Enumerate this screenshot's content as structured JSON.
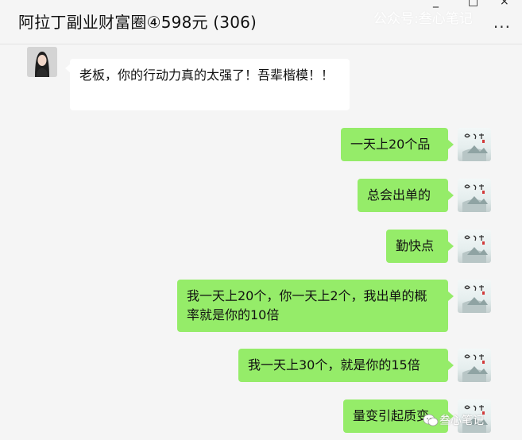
{
  "header": {
    "title": "阿拉丁副业财富圈④598元 (306)",
    "watermark": "公众号:叁心笔记",
    "more_label": "..."
  },
  "window_controls": {
    "minimize": "_",
    "maximize": "□",
    "close": "×"
  },
  "messages": [
    {
      "side": "left",
      "text": " 老板，你的行动力真的太强了！吾辈楷模！！"
    },
    {
      "side": "right",
      "text": "一天上20个品"
    },
    {
      "side": "right",
      "text": "总会出单的"
    },
    {
      "side": "right",
      "text": "勤快点"
    },
    {
      "side": "right",
      "text": "我一天上20个，你一天上2个，我出单的概率就是你的10倍"
    },
    {
      "side": "right",
      "text": "我一天上30个，就是你的15倍"
    },
    {
      "side": "right",
      "text": "量变引起质变"
    }
  ],
  "watermark_bottom": "叁心笔记",
  "colors": {
    "self_bubble": "#95ec69",
    "other_bubble": "#ffffff",
    "background": "#f5f5f5"
  }
}
